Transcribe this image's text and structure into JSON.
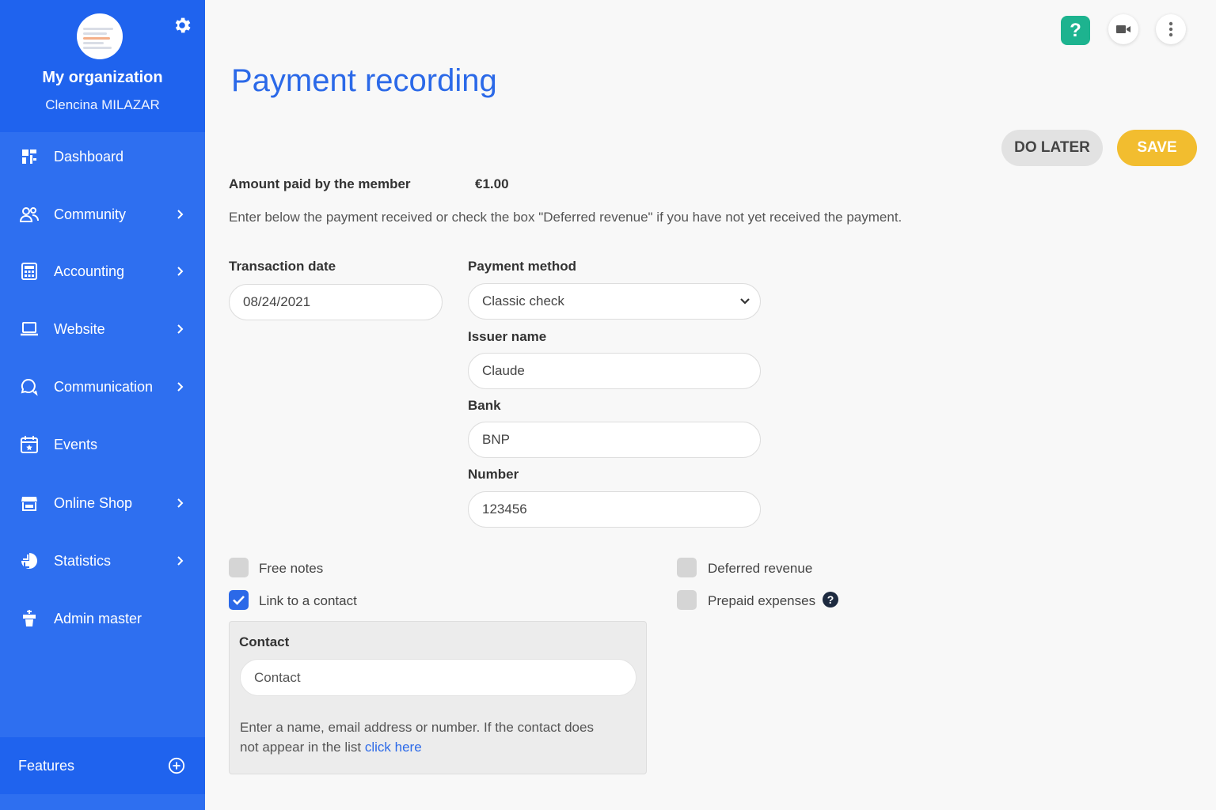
{
  "sidebar": {
    "org_name": "My organization",
    "user_name": "Clencina MILAZAR",
    "items": [
      {
        "label": "Dashboard"
      },
      {
        "label": "Community"
      },
      {
        "label": "Accounting"
      },
      {
        "label": "Website"
      },
      {
        "label": "Communication"
      },
      {
        "label": "Events"
      },
      {
        "label": "Online Shop"
      },
      {
        "label": "Statistics"
      },
      {
        "label": "Admin master"
      }
    ],
    "features_label": "Features"
  },
  "header": {
    "help_label": "?"
  },
  "page": {
    "title": "Payment recording",
    "do_later_label": "DO LATER",
    "save_label": "SAVE",
    "amount_label": "Amount paid by the member",
    "amount_value": "€1.00",
    "instructions": "Enter below the payment received or check the box \"Deferred revenue\" if you have not yet received the payment."
  },
  "form": {
    "transaction_date_label": "Transaction date",
    "transaction_date_value": "08/24/2021",
    "payment_method_label": "Payment method",
    "payment_method_value": "Classic check",
    "issuer_label": "Issuer name",
    "issuer_value": "Claude",
    "bank_label": "Bank",
    "bank_value": "BNP",
    "number_label": "Number",
    "number_value": "123456"
  },
  "checkboxes": {
    "free_notes": {
      "label": "Free notes",
      "checked": false
    },
    "link_contact": {
      "label": "Link to a contact",
      "checked": true
    },
    "deferred_revenue": {
      "label": "Deferred revenue",
      "checked": false
    },
    "prepaid_expenses": {
      "label": "Prepaid expenses",
      "checked": false
    }
  },
  "contact": {
    "title": "Contact",
    "placeholder": "Contact",
    "help_text": "Enter a name, email address or number. If the contact does not appear in the list",
    "help_link": "click here"
  },
  "colors": {
    "sidebar": "#2e6ff0",
    "accent": "#2b69e8",
    "save": "#f2bd2f",
    "help": "#1db38f"
  }
}
